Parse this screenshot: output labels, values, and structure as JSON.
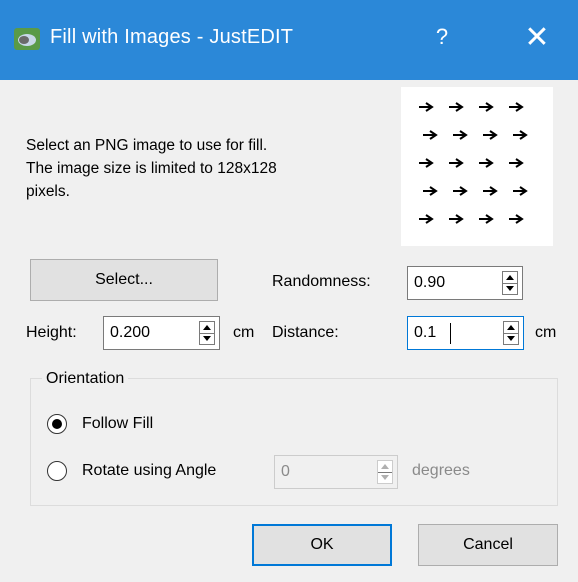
{
  "window": {
    "title": "Fill with Images - JustEDIT",
    "help_label": "?",
    "close_label": "✕",
    "titlebar_color": "#2b88d8",
    "icon": "justedit-app-icon"
  },
  "description": {
    "line1": "Select an  PNG image to use for fill.",
    "line2": "The image size is limited to 128x128",
    "line3": "pixels."
  },
  "preview": {
    "icon": "arrow-pattern-preview"
  },
  "select_button": {
    "label": "Select..."
  },
  "randomness": {
    "label": "Randomness:",
    "value": "0.90"
  },
  "height": {
    "label": "Height:",
    "value": "0.200",
    "unit": "cm"
  },
  "distance": {
    "label": "Distance:",
    "value": "0.1",
    "unit": "cm"
  },
  "orientation": {
    "title": "Orientation",
    "follow_fill": {
      "label": "Follow Fill",
      "checked": true
    },
    "rotate": {
      "label": "Rotate using Angle",
      "checked": false,
      "angle_value": "0",
      "unit": "degrees"
    }
  },
  "buttons": {
    "ok": "OK",
    "cancel": "Cancel"
  },
  "colors": {
    "accent": "#0078d7",
    "button_bg": "#e1e1e1",
    "dialog_bg": "#f0f0f0"
  }
}
